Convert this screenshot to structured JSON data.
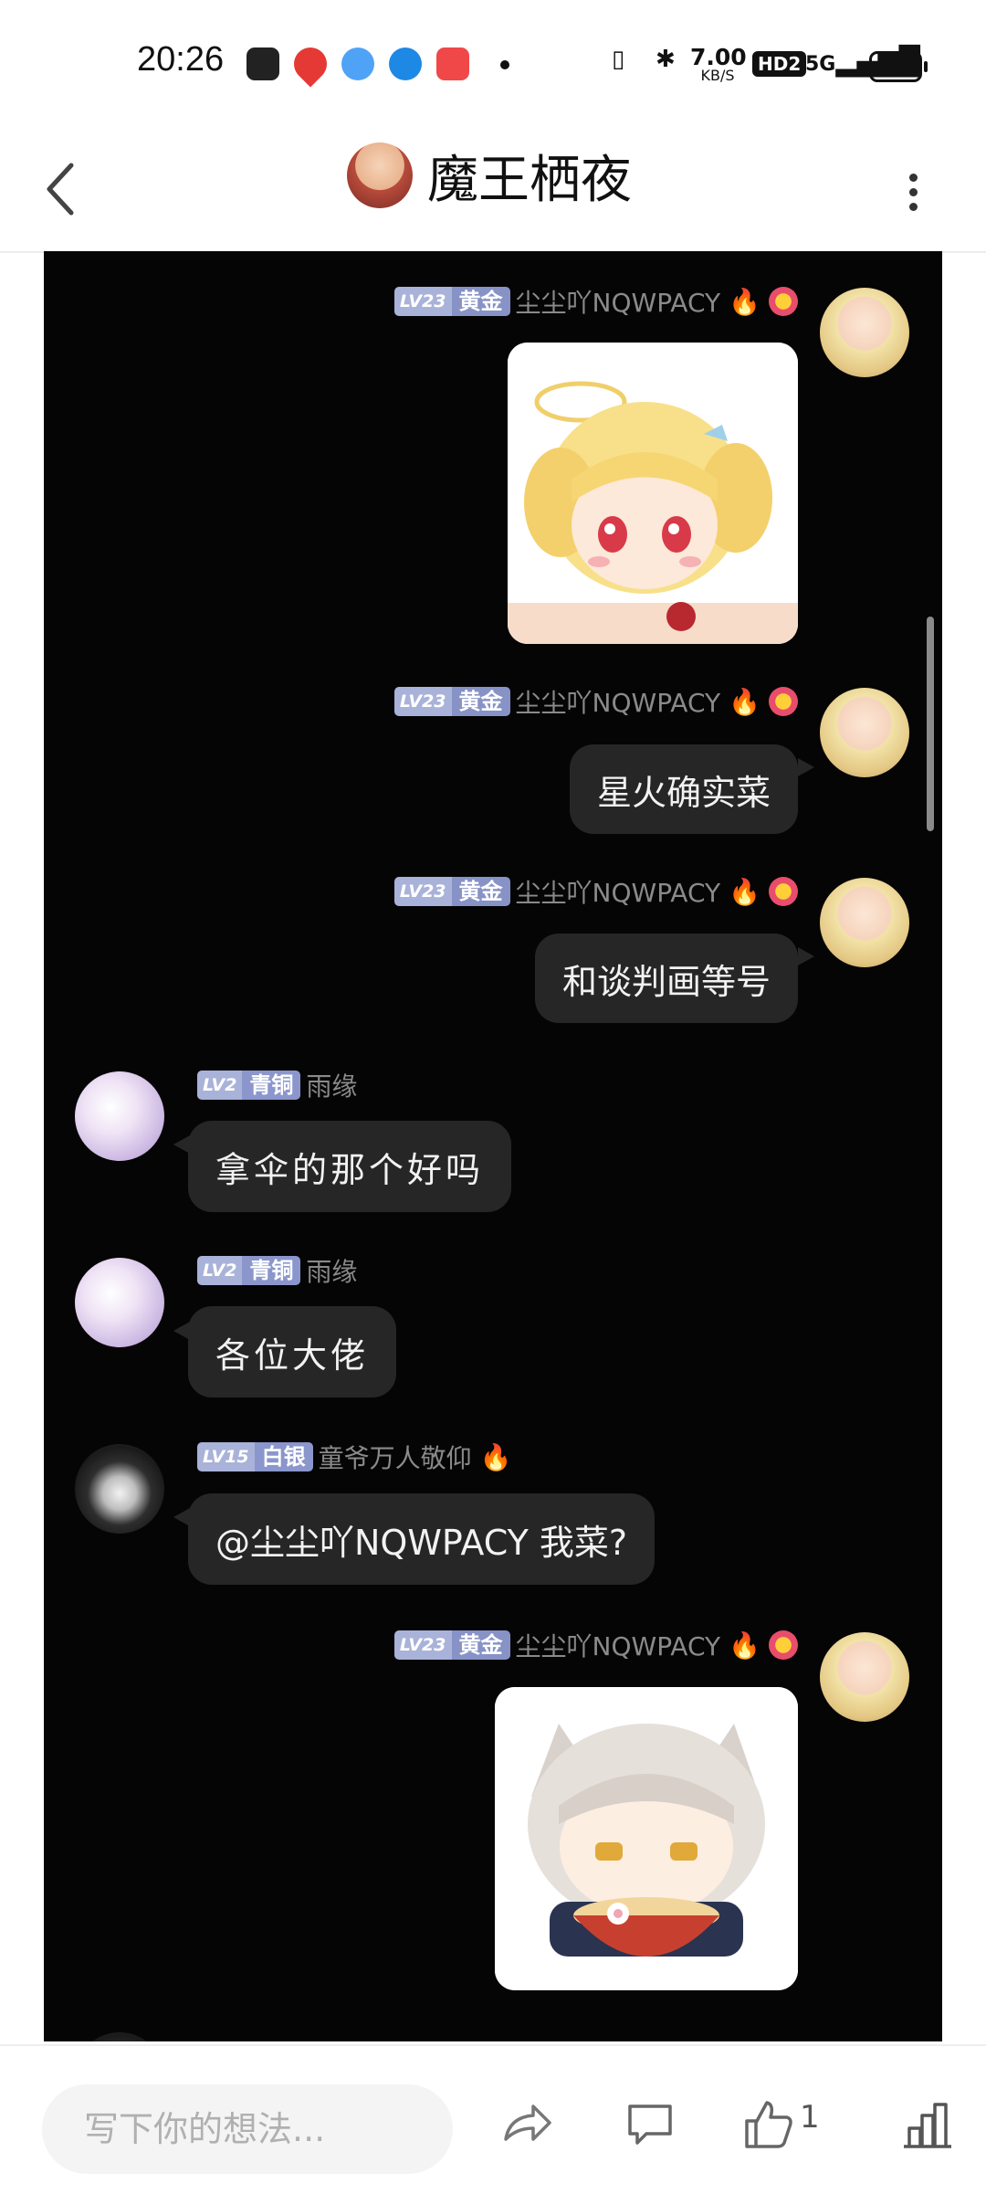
{
  "status_bar": {
    "time": "20:26",
    "speed_value": "7.00",
    "speed_unit": "KB/S",
    "hd": "HD2",
    "network": "5G",
    "battery": "55"
  },
  "header": {
    "title": "魔王栖夜"
  },
  "messages": [
    {
      "side": "right",
      "level": "LV23",
      "tier": "黄金",
      "name": "尘尘吖NQWPACY",
      "type": "sticker",
      "sticker": "anime-girl-halo-sticker"
    },
    {
      "side": "right",
      "level": "LV23",
      "tier": "黄金",
      "name": "尘尘吖NQWPACY",
      "type": "text",
      "text": "星火确实菜"
    },
    {
      "side": "right",
      "level": "LV23",
      "tier": "黄金",
      "name": "尘尘吖NQWPACY",
      "type": "text",
      "text": "和谈判画等号"
    },
    {
      "side": "left",
      "level": "LV2",
      "tier": "青铜",
      "name": "雨缘",
      "type": "text",
      "text": "拿伞的那个好吗"
    },
    {
      "side": "left",
      "level": "LV2",
      "tier": "青铜",
      "name": "雨缘",
      "type": "text",
      "text": "各位大佬"
    },
    {
      "side": "left",
      "level": "LV15",
      "tier": "白银",
      "name": "童爷万人敬仰",
      "type": "text",
      "text": "@尘尘吖NQWPACY 我菜?"
    },
    {
      "side": "right",
      "level": "LV23",
      "tier": "黄金",
      "name": "尘尘吖NQWPACY",
      "type": "sticker",
      "sticker": "cat-girl-ramen-sticker"
    }
  ],
  "bottom_bar": {
    "input_placeholder": "写下你的想法...",
    "like_count": "1"
  }
}
